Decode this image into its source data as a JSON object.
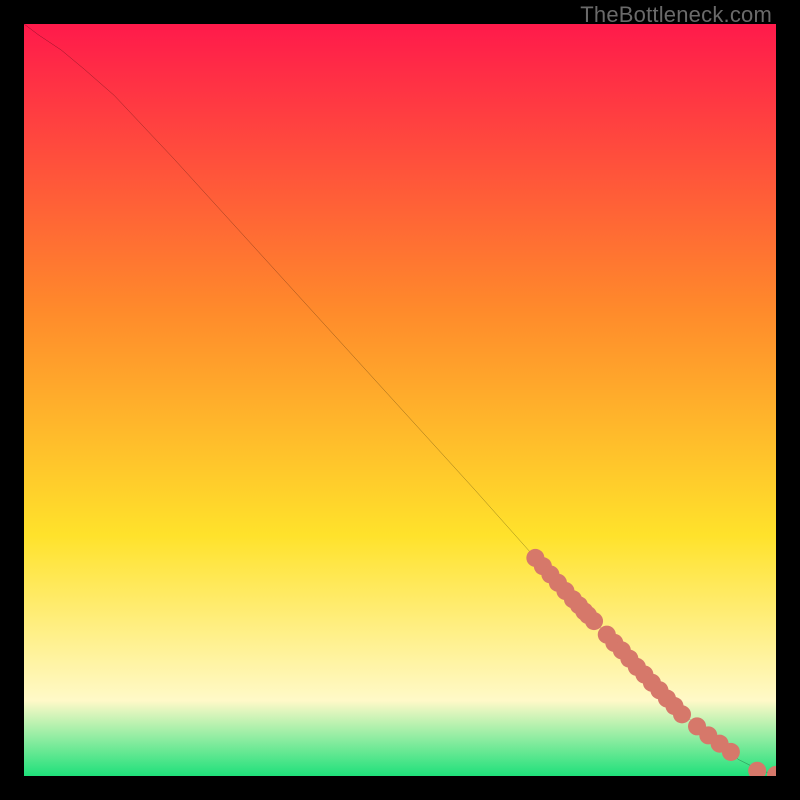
{
  "watermark": "TheBottleneck.com",
  "colors": {
    "dot": "#d6786a",
    "line": "#000000",
    "grad_top": "#ff1a4b",
    "grad_mid1": "#ff8a2b",
    "grad_mid2": "#ffe22b",
    "grad_mid3": "#fff9c8",
    "grad_bot": "#1ee07a"
  },
  "chart_data": {
    "type": "line",
    "title": "",
    "xlabel": "",
    "ylabel": "",
    "xlim": [
      0,
      100
    ],
    "ylim": [
      0,
      100
    ],
    "series": [
      {
        "name": "curve",
        "x": [
          0,
          2,
          5,
          8,
          12,
          20,
          30,
          40,
          50,
          60,
          68,
          75,
          82,
          88,
          92,
          95,
          97,
          98.5,
          99.5,
          100
        ],
        "y": [
          100,
          98.5,
          96.5,
          94,
          90.5,
          82,
          71,
          60,
          49,
          38,
          29,
          21.5,
          14,
          8,
          4.5,
          2.2,
          1.2,
          0.6,
          0.25,
          0.15
        ]
      }
    ],
    "scatter": [
      {
        "name": "cluster_upper",
        "x": [
          68.0,
          69.0,
          70.0,
          71.0,
          72.0,
          73.0,
          73.8,
          74.5,
          75.0,
          75.8
        ],
        "y": [
          29.0,
          27.9,
          26.8,
          25.7,
          24.6,
          23.5,
          22.7,
          21.9,
          21.4,
          20.6
        ]
      },
      {
        "name": "cluster_mid",
        "x": [
          77.5,
          78.5,
          79.5,
          80.5,
          81.5,
          82.5,
          83.5,
          84.5,
          85.5,
          86.5,
          87.5
        ],
        "y": [
          18.8,
          17.7,
          16.7,
          15.6,
          14.5,
          13.5,
          12.4,
          11.4,
          10.3,
          9.3,
          8.2
        ]
      },
      {
        "name": "cluster_low",
        "x": [
          89.5,
          91.0,
          92.5,
          94.0
        ],
        "y": [
          6.6,
          5.4,
          4.3,
          3.2
        ]
      },
      {
        "name": "tail",
        "x": [
          97.5,
          100.0
        ],
        "y": [
          0.7,
          0.15
        ]
      }
    ],
    "dot_radius": 1.2
  }
}
